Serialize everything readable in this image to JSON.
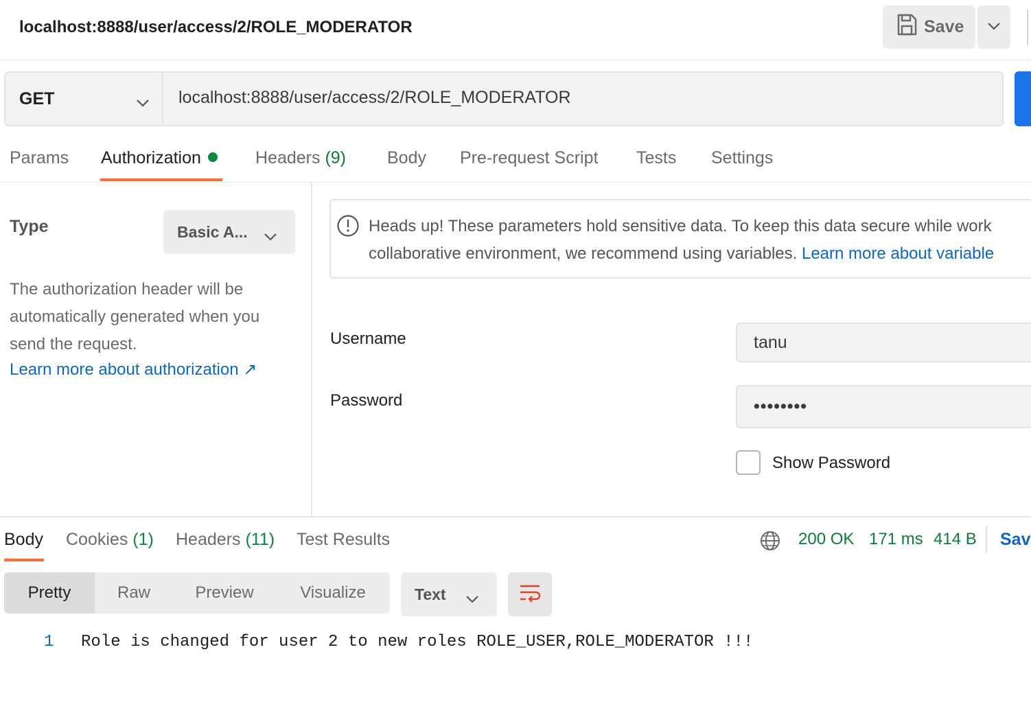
{
  "header": {
    "title": "localhost:8888/user/access/2/ROLE_MODERATOR",
    "save_label": "Save"
  },
  "request": {
    "method": "GET",
    "url": "localhost:8888/user/access/2/ROLE_MODERATOR"
  },
  "request_tabs": [
    {
      "label": "Params"
    },
    {
      "label": "Authorization",
      "active": true,
      "indicator": "green-dot"
    },
    {
      "label": "Headers",
      "count": "(9)"
    },
    {
      "label": "Body"
    },
    {
      "label": "Pre-request Script"
    },
    {
      "label": "Tests"
    },
    {
      "label": "Settings"
    }
  ],
  "auth": {
    "type_label": "Type",
    "type_value": "Basic A...",
    "description": "The authorization header will be automatically generated when you send the request.",
    "learn_link": "Learn more about authorization ↗",
    "notice_line1": "Heads up! These parameters hold sensitive data. To keep this data secure while work",
    "notice_line2": "collaborative environment, we recommend using variables. ",
    "notice_link": "Learn more about variable",
    "username_label": "Username",
    "username_value": "tanu",
    "password_label": "Password",
    "password_value": "••••••••",
    "show_password_label": "Show Password",
    "show_password_checked": false
  },
  "response_tabs": [
    {
      "label": "Body",
      "active": true
    },
    {
      "label": "Cookies",
      "count": "(1)"
    },
    {
      "label": "Headers",
      "count": "(11)"
    },
    {
      "label": "Test Results"
    }
  ],
  "response_status": {
    "status": "200 OK",
    "time": "171 ms",
    "size": "414 B",
    "save_label": "Save"
  },
  "view_options": [
    "Pretty",
    "Raw",
    "Preview",
    "Visualize"
  ],
  "active_view": "Pretty",
  "format": "Text",
  "response_body": {
    "line_number": "1",
    "text": "Role is changed for user 2 to new roles ROLE_USER,ROLE_MODERATOR !!!"
  },
  "colors": {
    "accent_tab": "#ff6c37",
    "link": "#0b67c9",
    "status_green": "#0a7d3e",
    "send_blue": "#1a73e8"
  }
}
